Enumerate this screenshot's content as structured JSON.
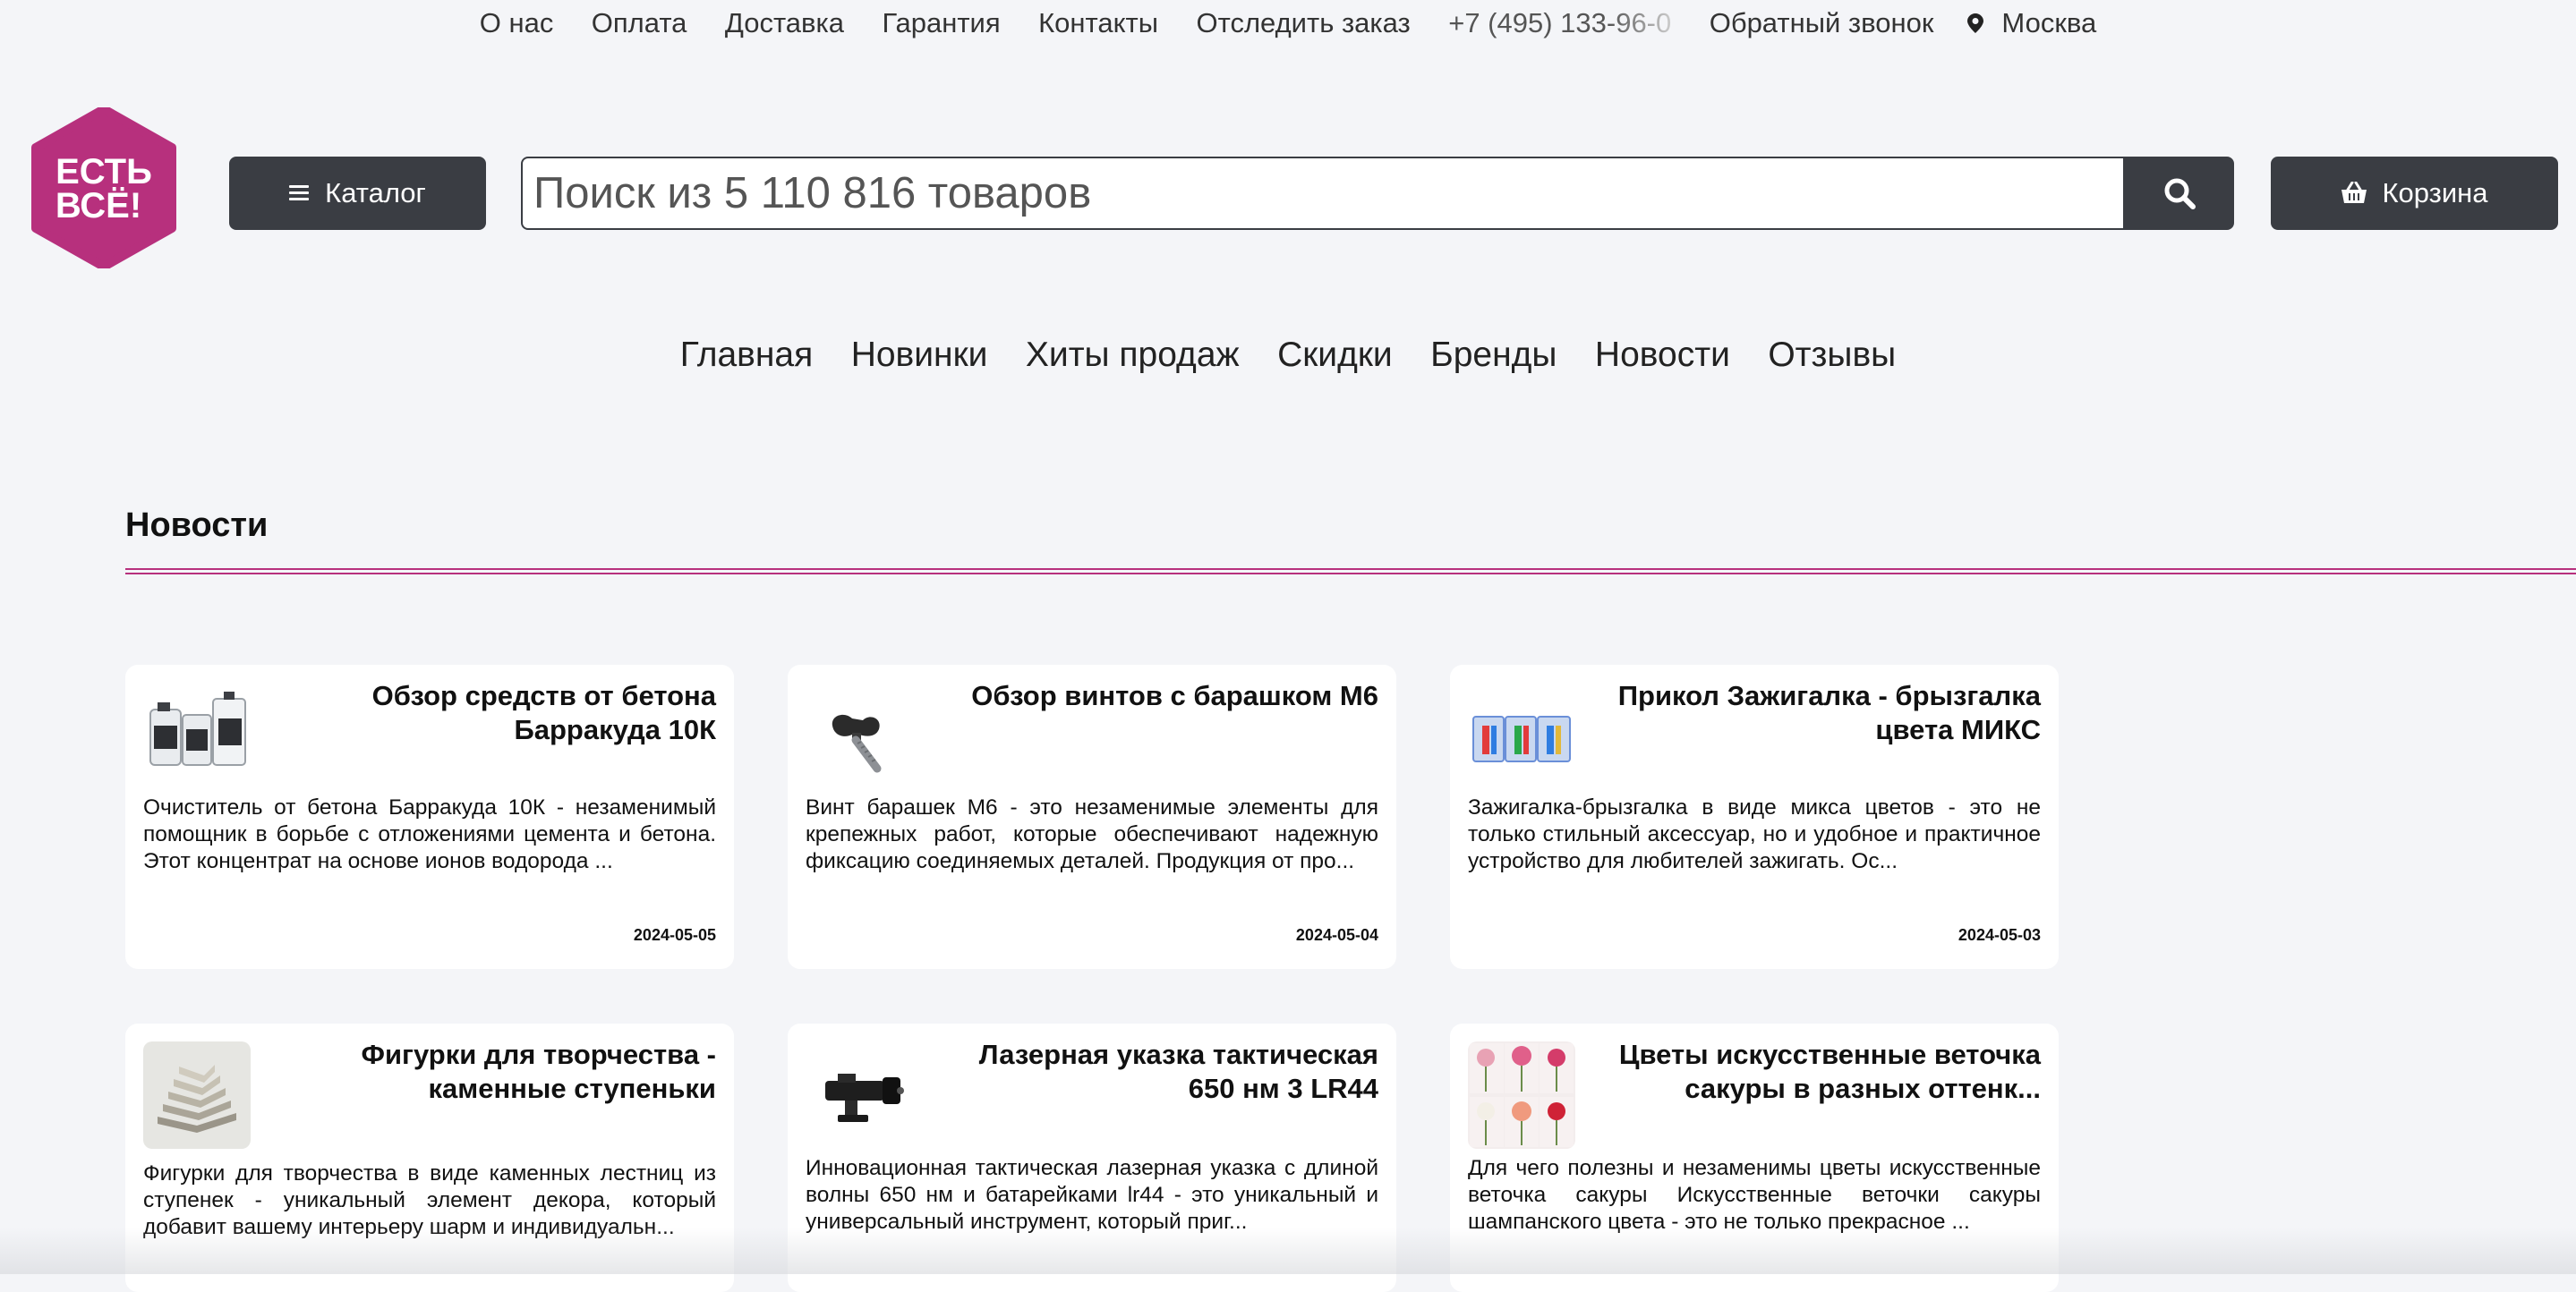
{
  "topbar": {
    "links": [
      "О нас",
      "Оплата",
      "Доставка",
      "Гарантия",
      "Контакты",
      "Отследить заказ"
    ],
    "phone": "+7 (495) 133-96-0",
    "callback": "Обратный звонок",
    "city": "Москва"
  },
  "logo": {
    "line1": "ЕСТЬ",
    "line2": "ВСЁ!"
  },
  "catalog_label": "Каталог",
  "search": {
    "placeholder": "Поиск из 5 110 816 товаров"
  },
  "cart_label": "Корзина",
  "nav": [
    "Главная",
    "Новинки",
    "Хиты продаж",
    "Скидки",
    "Бренды",
    "Новости",
    "Отзывы"
  ],
  "section_title": "Новости",
  "news": [
    {
      "title": "Обзор средств от бетона Барракуда 10К",
      "excerpt": "Очиститель от бетона Барракуда 10К - незаменимый помощник в борьбе с отложениями цемента и бетона. Этот концентрат на основе ионов водорода ...",
      "date": "2024-05-05"
    },
    {
      "title": "Обзор винтов с барашком М6",
      "excerpt": "Винт барашек М6 - это незаменимые элементы для крепежных работ, которые обеспечивают надежную фиксацию соединяемых деталей. Продукция от про...",
      "date": "2024-05-04"
    },
    {
      "title": "Прикол Зажигалка - брызгалка цвета МИКС",
      "excerpt": "Зажигалка-брызгалка в виде микса цветов - это не только стильный аксессуар, но и удобное и практичное устройство для любителей зажигать. Ос...",
      "date": "2024-05-03"
    },
    {
      "title": "Фигурки для творчества - каменные ступеньки",
      "excerpt": "Фигурки для творчества в виде каменных лестниц из ступенек - уникальный элемент декора, который добавит вашему интерьеру шарм и индивидуальн..."
    },
    {
      "title": "Лазерная указка тактическая 650 нм 3 LR44",
      "excerpt": "Инновационная тактическая лазерная указка с длиной волны 650 нм и батарейками lr44 - это уникальный и универсальный инструмент, который приг..."
    },
    {
      "title": "Цветы искусственные веточка сакуры в разных оттенк...",
      "excerpt": "Для чего полезны и незаменимы цветы искусственные веточка сакуры Искусственные веточки сакуры шампанского цвета - это не только прекрасное ..."
    }
  ],
  "colors": {
    "brand": "#b7307d",
    "button": "#3a3d43",
    "background": "#f4f5f8"
  }
}
